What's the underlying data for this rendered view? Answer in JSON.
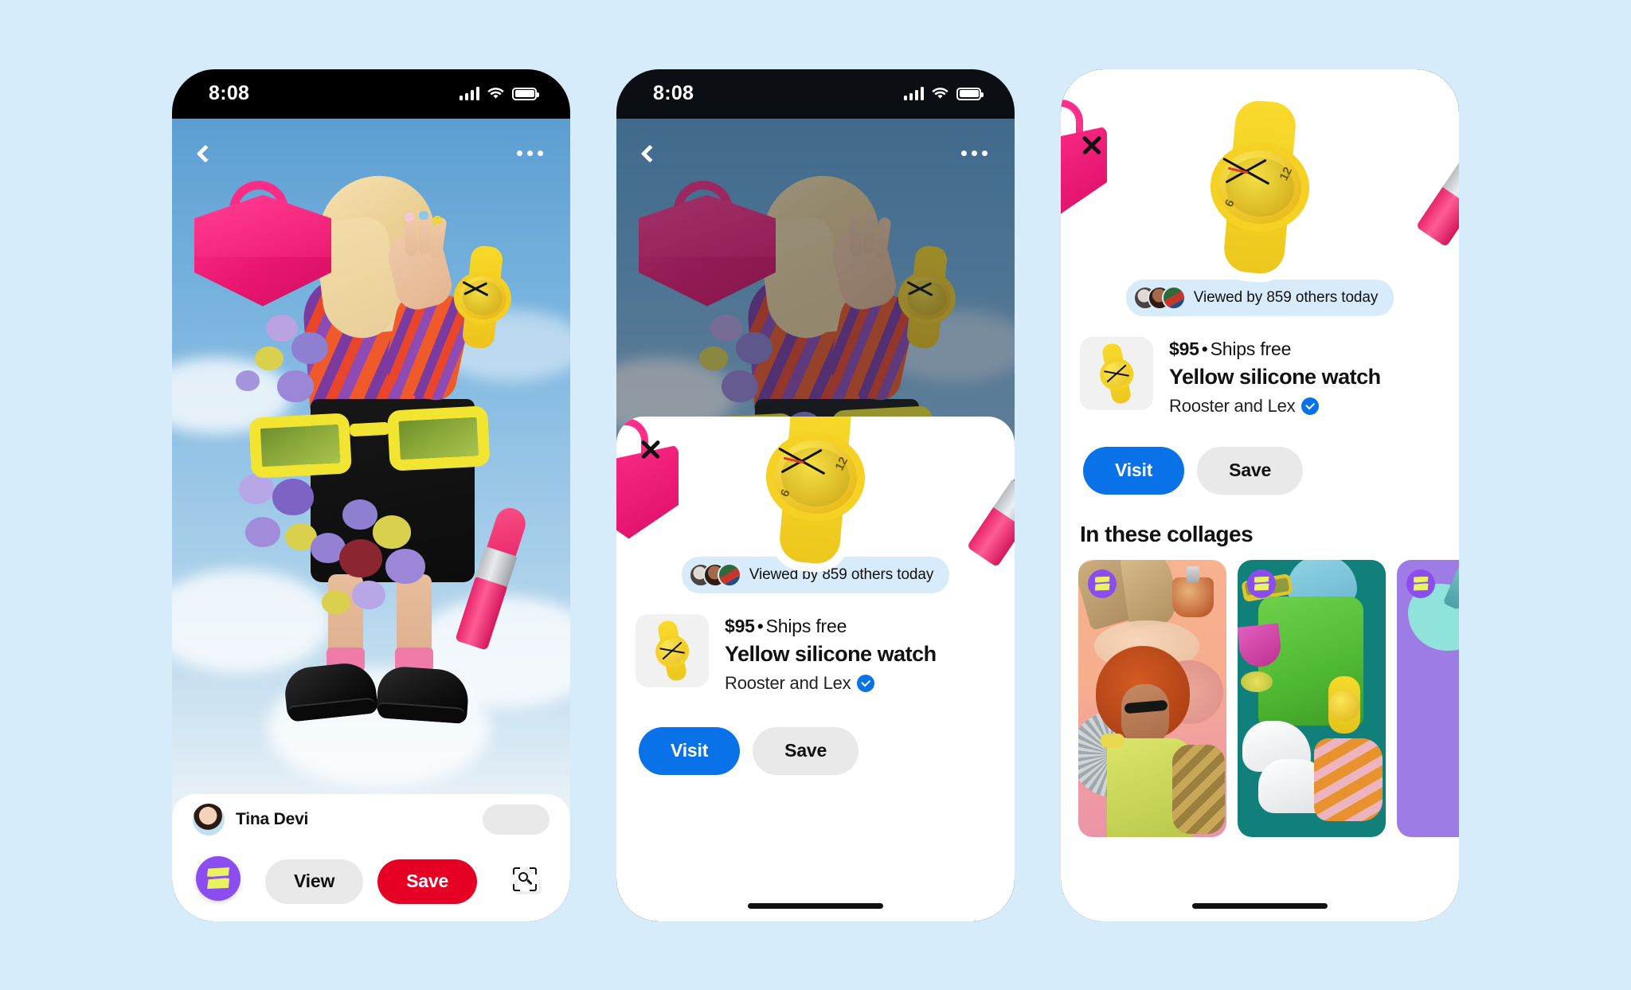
{
  "background_color": "#d6ecfb",
  "brand_colors": {
    "save_red": "#e60023",
    "visit_blue": "#0a72e8",
    "chip_gray": "#e9e9e9",
    "collage_purple": "#8b4df0",
    "badge_lime": "#e9f260",
    "pill_blue": "#d8ebfb"
  },
  "status_bar": {
    "time": "8:08",
    "signal_icon": "cellular-signal-icon",
    "wifi_icon": "wifi-icon",
    "battery_icon": "battery-full-icon"
  },
  "phone1": {
    "top_bar": {
      "back_icon": "chevron-left-icon",
      "more_icon": "overflow-menu-icon"
    },
    "image": {
      "alt": "Fashion collage: woman with blonde bob in orange and purple swirl top, pink handbag, yellow watch, oversized yellow sunglasses, purple pansies, black skirt, black loafers, pink lipstick, sky background",
      "collage_badge_icon": "collage-badge-icon",
      "visual_search_icon": "visual-search-lens-icon"
    },
    "creator": {
      "name": "Tina Devi",
      "avatar_icon": "creator-avatar",
      "follow_label": ""
    },
    "action_bar": {
      "comment_icon": "comment-heart-icon",
      "view_label": "View",
      "save_label": "Save",
      "share_icon": "share-icon"
    }
  },
  "phone2": {
    "top_bar": {
      "back_icon": "chevron-left-icon",
      "more_icon": "overflow-menu-icon"
    },
    "sheet": {
      "close_icon": "close-x-icon",
      "hero_alt": "Yellow silicone watch sticker with pink handbag and pink lipstick",
      "viewed_text": "Viewed by 859 others today",
      "viewed_count": 859,
      "avatars": [
        "viewer-avatar-1",
        "viewer-avatar-2",
        "viewer-avatar-3"
      ],
      "product": {
        "thumbnail_icon": "product-thumbnail-watch",
        "price": "$95",
        "separator": "•",
        "shipping": "Ships free",
        "title": "Yellow silicone watch",
        "merchant": "Rooster and Lex",
        "verified_icon": "verified-badge-icon"
      },
      "cta": {
        "visit_label": "Visit",
        "save_label": "Save"
      }
    },
    "home_indicator": "home-indicator"
  },
  "phone3": {
    "close_icon": "close-x-icon",
    "hero_alt": "Yellow silicone watch sticker with pink handbag and pink lipstick",
    "viewed_text": "Viewed by 859 others today",
    "viewed_count": 859,
    "avatars": [
      "viewer-avatar-1",
      "viewer-avatar-2",
      "viewer-avatar-3"
    ],
    "product": {
      "thumbnail_icon": "product-thumbnail-watch",
      "price": "$95",
      "separator": "•",
      "shipping": "Ships free",
      "title": "Yellow silicone watch",
      "merchant": "Rooster and Lex",
      "verified_icon": "verified-badge-icon"
    },
    "cta": {
      "visit_label": "Visit",
      "save_label": "Save"
    },
    "collages_section": {
      "heading": "In these collages",
      "items": [
        {
          "alt": "Peach collage with gold boots, perfume bottle, disco ball and woman with red afro in green dress",
          "badge_icon": "collage-badge-icon"
        },
        {
          "alt": "Teal collage with green shirt, blue headwrap, yellow sunglasses, yellow watch, white sneakers and striped towel",
          "badge_icon": "collage-badge-icon"
        },
        {
          "alt": "Purple collage with mint paint blob, orange hat and orange patterned top",
          "badge_icon": "collage-badge-icon"
        }
      ]
    },
    "home_indicator": "home-indicator"
  }
}
